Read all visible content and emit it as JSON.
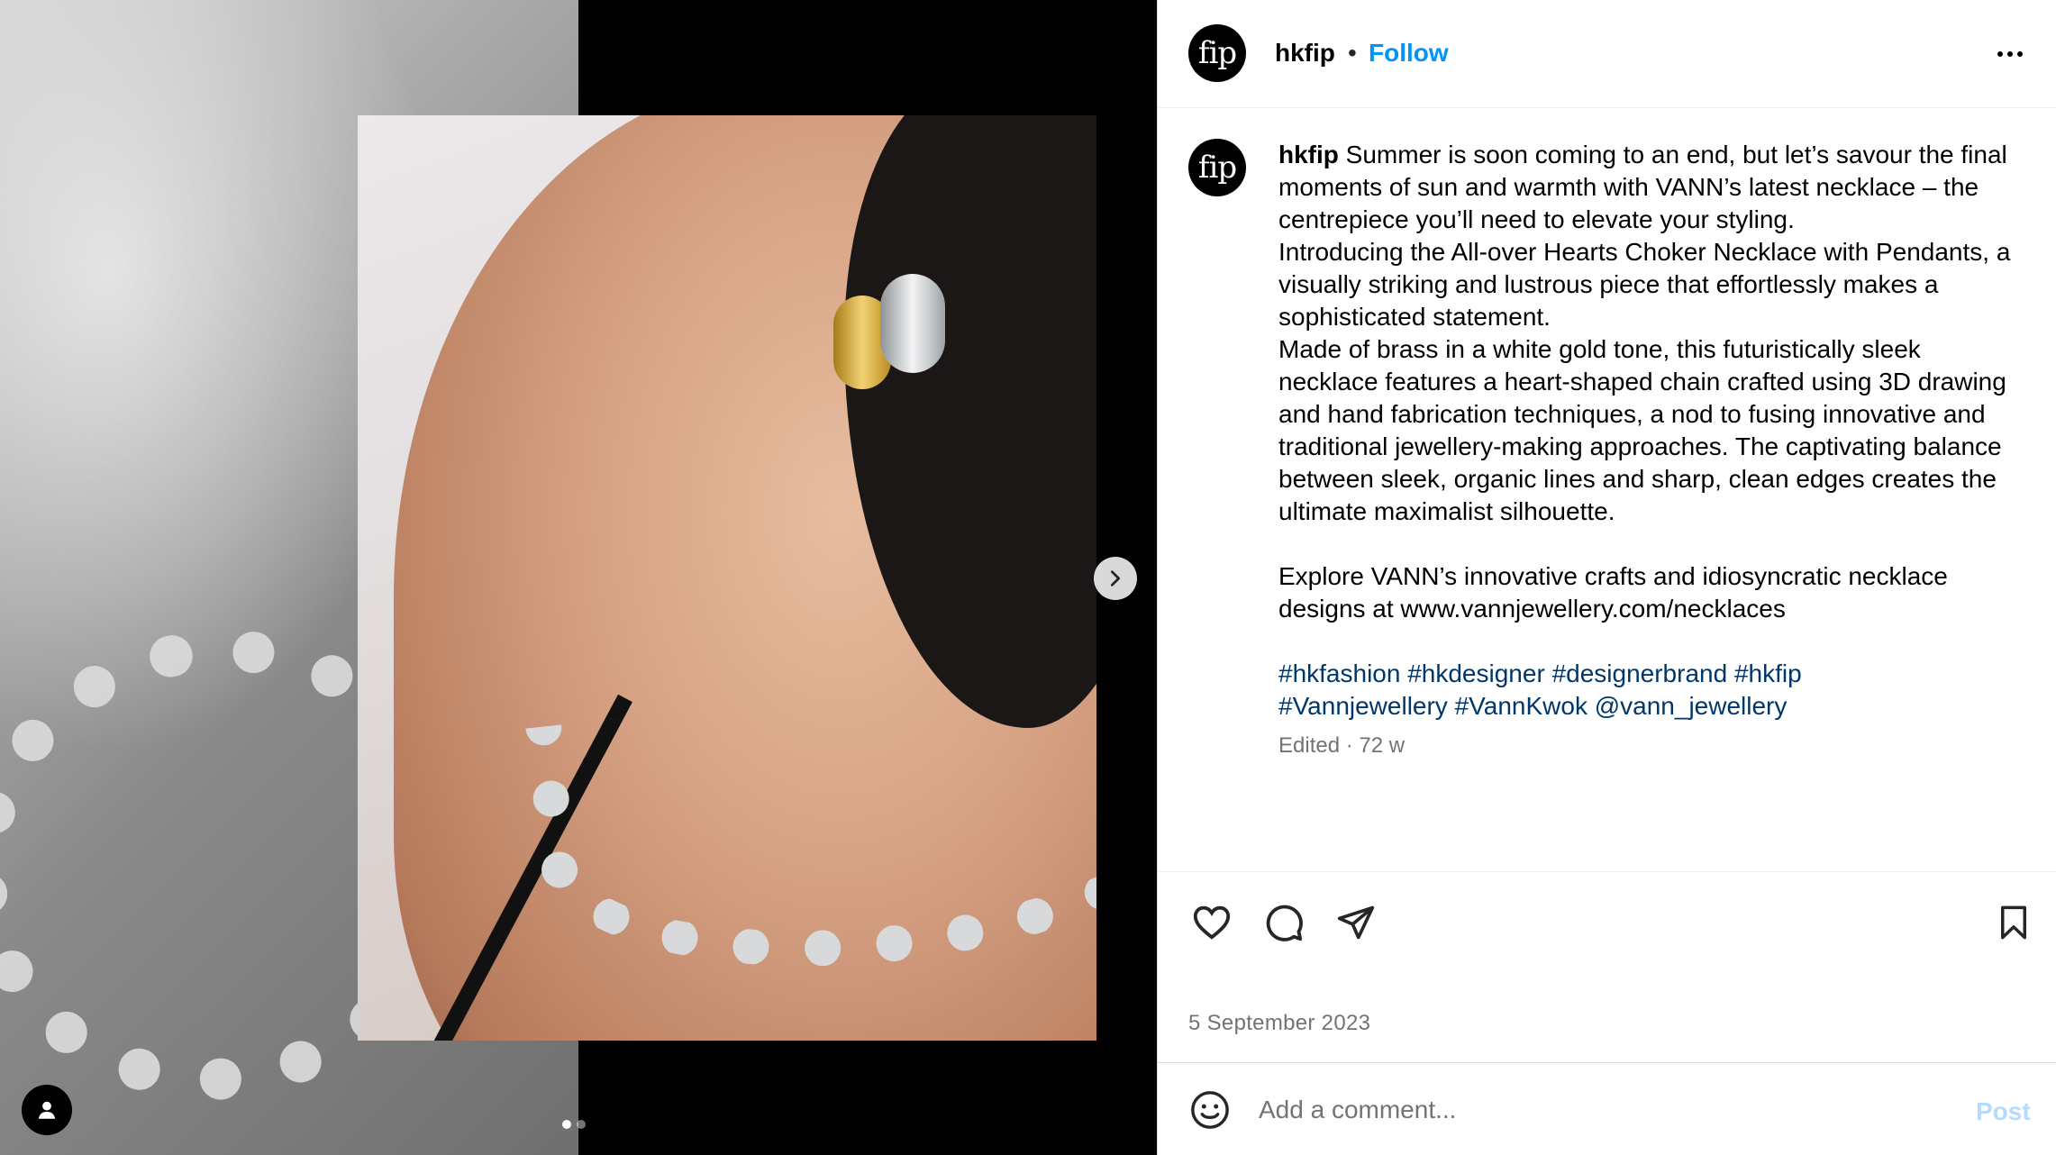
{
  "media": {
    "carousel_total": 2,
    "carousel_current": 1
  },
  "header": {
    "avatar_text": "fip",
    "username": "hkfip",
    "separator": "•",
    "follow_label": "Follow"
  },
  "caption": {
    "avatar_text": "fip",
    "username": "hkfip",
    "lines": [
      "Summer is soon coming to an end, but let’s savour the final moments of sun and warmth with VANN’s latest necklace – the centrepiece you’ll need to elevate your styling.",
      "Introducing the All-over Hearts Choker Necklace with Pendants, a visually striking and lustrous piece that effortlessly makes a sophisticated statement.",
      "Made of brass in a white gold tone, this futuristically sleek necklace features a heart-shaped chain crafted using 3D drawing and hand fabrication techniques, a nod to fusing innovative and traditional jewellery-making approaches. The captivating balance between sleek, organic lines and sharp, clean edges creates the ultimate maximalist silhouette.",
      "Explore VANN’s innovative crafts and idiosyncratic necklace designs at www.vannjewellery.com/necklaces"
    ],
    "hashtags": [
      "#hkfashion",
      "#hkdesigner",
      "#designerbrand",
      "#hkfip",
      "#Vannjewellery",
      "#VannKwok",
      "@vann_jewellery"
    ],
    "meta": "Edited · 72 w"
  },
  "actions": {
    "date": "5 September 2023"
  },
  "comment": {
    "placeholder": "Add a comment...",
    "post_label": "Post"
  },
  "colors": {
    "link_blue": "#0095f6",
    "hashtag_blue": "#00376b",
    "muted_text": "#737373",
    "post_disabled": "#b3dbff"
  },
  "icons": [
    "chevron-right-icon",
    "user-tag-icon",
    "more-icon",
    "heart-icon",
    "comment-icon",
    "share-icon",
    "bookmark-icon",
    "emoji-icon"
  ]
}
